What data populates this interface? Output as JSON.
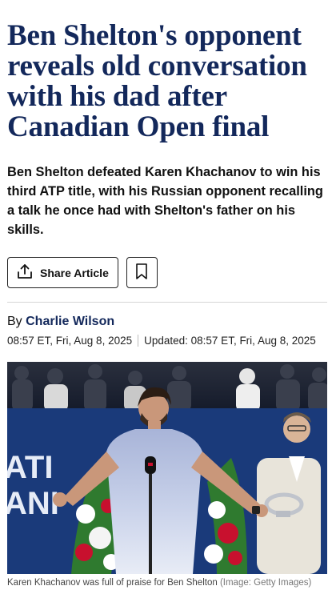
{
  "article": {
    "headline": "Ben Shelton's opponent reveals old conversation with his dad after Canadian Open final",
    "standfirst": "Ben Shelton defeated Karen Khachanov to win his third ATP title, with his Russian opponent recalling a talk he once had with Shelton's father on his skills.",
    "share_label": "Share Article",
    "byline_prefix": "By",
    "author": "Charlie Wilson",
    "published": "08:57 ET, Fri, Aug 8, 2025",
    "updated": "Updated: 08:57 ET, Fri, Aug 8, 2025",
    "photo_banner_text": "ATI ANI",
    "caption": "Karen Khachanov was full of praise for Ben Shelton",
    "credit": "(Image: Getty Images)"
  },
  "colors": {
    "headline": "#13285b",
    "author": "#13285b",
    "banner": "#1a3a7a"
  },
  "icons": {
    "share": "share-upload-icon",
    "bookmark": "bookmark-icon"
  }
}
